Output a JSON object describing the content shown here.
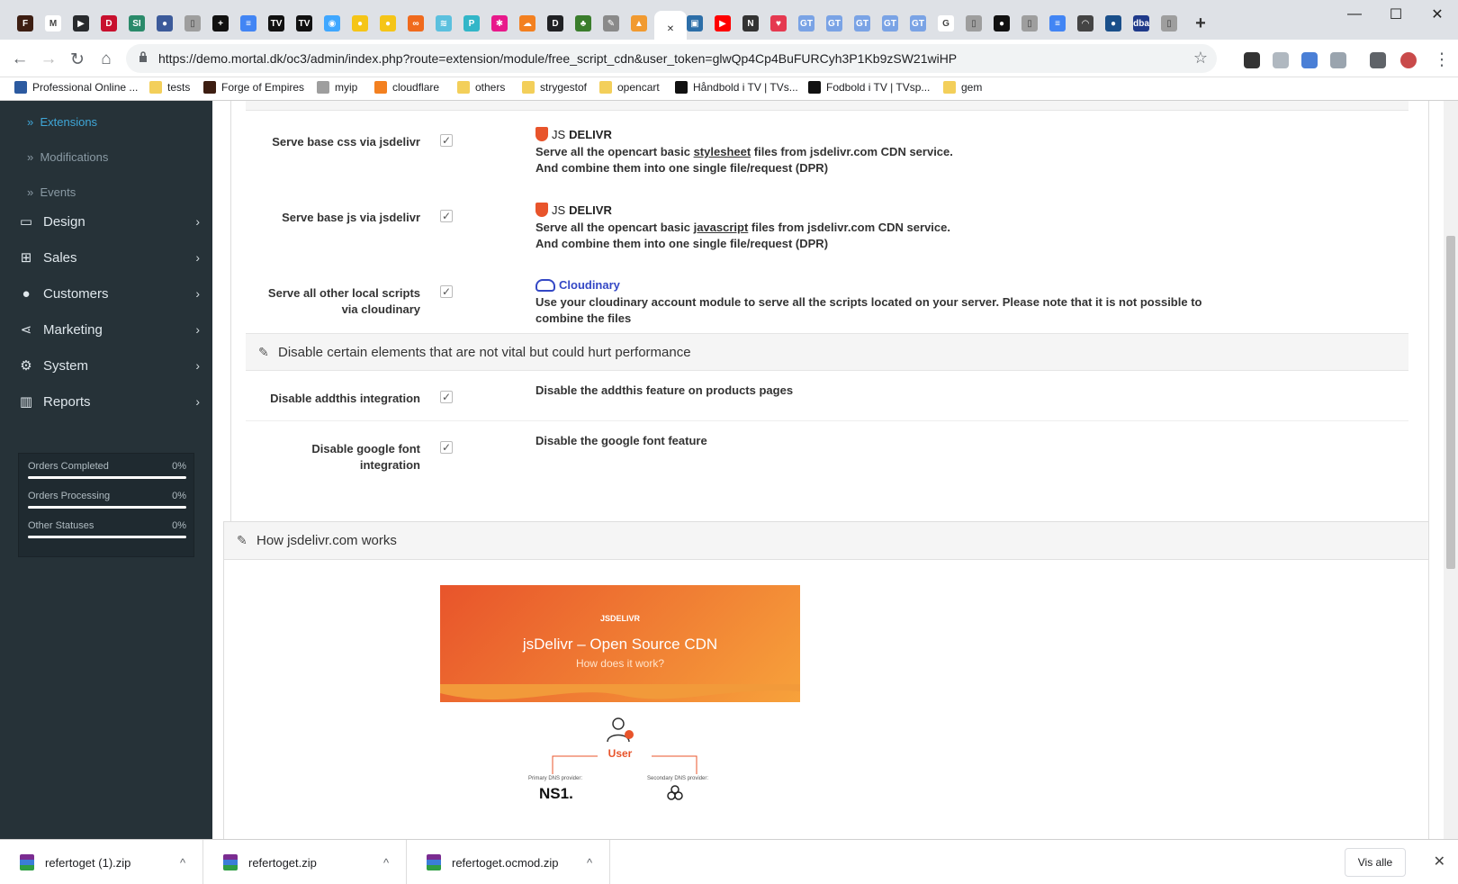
{
  "browser": {
    "tabs": [
      {
        "icon": "forge-icon",
        "color": "#3d1e12",
        "glyph": "F"
      },
      {
        "icon": "gmail-icon",
        "color": "#ffffff",
        "glyph": "M"
      },
      {
        "icon": "plex-icon",
        "color": "#282a2d",
        "glyph": "▶"
      },
      {
        "icon": "d-icon",
        "color": "#c8102e",
        "glyph": "D"
      },
      {
        "icon": "si-icon",
        "color": "#2a8a6a",
        "glyph": "SI"
      },
      {
        "icon": "avatar-tab-icon",
        "color": "#3c5a9a",
        "glyph": "●"
      },
      {
        "icon": "page-icon",
        "color": "#9e9e9e",
        "glyph": "▯"
      },
      {
        "icon": "plus-tab-icon",
        "color": "#111111",
        "glyph": "+"
      },
      {
        "icon": "docs-icon",
        "color": "#4285f4",
        "glyph": "≡"
      },
      {
        "icon": "tv-icon",
        "color": "#111111",
        "glyph": "TV"
      },
      {
        "icon": "tv2-icon",
        "color": "#111111",
        "glyph": "TV"
      },
      {
        "icon": "blue-circle-icon",
        "color": "#3fa7ff",
        "glyph": "◉"
      },
      {
        "icon": "yellow-icon",
        "color": "#f5c518",
        "glyph": "●"
      },
      {
        "icon": "yellow2-icon",
        "color": "#f5c518",
        "glyph": "●"
      },
      {
        "icon": "orange-link-icon",
        "color": "#f06a1d",
        "glyph": "∞"
      },
      {
        "icon": "chart-tab-icon",
        "color": "#5bc0de",
        "glyph": "≋"
      },
      {
        "icon": "p-icon",
        "color": "#32b6c8",
        "glyph": "P"
      },
      {
        "icon": "pink-icon",
        "color": "#e8198b",
        "glyph": "✱"
      },
      {
        "icon": "cloudflare-tab-icon",
        "color": "#f38020",
        "glyph": "☁"
      },
      {
        "icon": "d-dark-icon",
        "color": "#202124",
        "glyph": "D"
      },
      {
        "icon": "green-icon",
        "color": "#3a7d2c",
        "glyph": "♣"
      },
      {
        "icon": "feather-icon",
        "color": "#8a8a8a",
        "glyph": "✎"
      },
      {
        "icon": "pma-icon",
        "color": "#f19a30",
        "glyph": "▲"
      },
      {
        "icon": "close-tab-icon",
        "color": "#ffffff",
        "glyph": "✕"
      },
      {
        "icon": "film-icon",
        "color": "#2c6ea8",
        "glyph": "▣"
      },
      {
        "icon": "youtube-icon",
        "color": "#ff0000",
        "glyph": "▶"
      },
      {
        "icon": "n-icon",
        "color": "#333333",
        "glyph": "N"
      },
      {
        "icon": "heart-icon",
        "color": "#e53950",
        "glyph": "♥"
      },
      {
        "icon": "gt-icon",
        "color": "#7aa3e5",
        "glyph": "GT"
      },
      {
        "icon": "gt-icon",
        "color": "#7aa3e5",
        "glyph": "GT"
      },
      {
        "icon": "gt-icon",
        "color": "#7aa3e5",
        "glyph": "GT"
      },
      {
        "icon": "gt-icon",
        "color": "#7aa3e5",
        "glyph": "GT"
      },
      {
        "icon": "gt-icon",
        "color": "#7aa3e5",
        "glyph": "GT"
      },
      {
        "icon": "google-icon",
        "color": "#ffffff",
        "glyph": "G"
      },
      {
        "icon": "page-icon",
        "color": "#9e9e9e",
        "glyph": "▯"
      },
      {
        "icon": "github-icon",
        "color": "#111111",
        "glyph": "●"
      },
      {
        "icon": "page-icon",
        "color": "#9e9e9e",
        "glyph": "▯"
      },
      {
        "icon": "docs-icon",
        "color": "#4285f4",
        "glyph": "≡"
      },
      {
        "icon": "gauge-icon",
        "color": "#444444",
        "glyph": "◠"
      },
      {
        "icon": "globe-icon",
        "color": "#1a4f8a",
        "glyph": "●"
      },
      {
        "icon": "dba-icon",
        "color": "#1f3a8a",
        "glyph": "dba"
      },
      {
        "icon": "page-icon",
        "color": "#9e9e9e",
        "glyph": "▯"
      }
    ],
    "new_tab": "+",
    "window_controls": [
      "—",
      "☐",
      "✕"
    ],
    "url": "https://demo.mortal.dk/oc3/admin/index.php?route=extension/module/free_script_cdn&user_token=glwQp4Cp4BuFURCyh3P1Kb9zSW21wiHP",
    "bookmarks": [
      {
        "label": "Professional Online ...",
        "icon": "s-logo-icon",
        "color": "#2c5aa0"
      },
      {
        "label": "tests",
        "icon": "folder-icon",
        "color": "#f3cf5a"
      },
      {
        "label": "Forge of Empires",
        "icon": "forge-icon",
        "color": "#3d1e12"
      },
      {
        "label": "myip",
        "icon": "page-icon",
        "color": "#9e9e9e"
      },
      {
        "label": "cloudflare",
        "icon": "cloudflare-icon",
        "color": "#f38020"
      },
      {
        "label": "others",
        "icon": "folder-icon",
        "color": "#f3cf5a"
      },
      {
        "label": "strygestof",
        "icon": "folder-icon",
        "color": "#f3cf5a"
      },
      {
        "label": "opencart",
        "icon": "folder-icon",
        "color": "#f3cf5a"
      },
      {
        "label": "Håndbold i TV | TVs...",
        "icon": "tv-icon",
        "color": "#111111"
      },
      {
        "label": "Fodbold i TV | TVsp...",
        "icon": "tv-icon",
        "color": "#111111"
      },
      {
        "label": "gem",
        "icon": "folder-icon",
        "color": "#f3cf5a"
      }
    ]
  },
  "sidebar": {
    "sub_items": [
      {
        "label": "Extensions",
        "active": true
      },
      {
        "label": "Modifications",
        "active": false
      },
      {
        "label": "Events",
        "active": false
      }
    ],
    "sub_prefix": "»",
    "menu": [
      {
        "label": "Design",
        "icon": "desktop-icon",
        "glyph": "▭"
      },
      {
        "label": "Sales",
        "icon": "cart-icon",
        "glyph": "🛒"
      },
      {
        "label": "Customers",
        "icon": "user-icon",
        "glyph": "👤"
      },
      {
        "label": "Marketing",
        "icon": "share-icon",
        "glyph": "⋖"
      },
      {
        "label": "System",
        "icon": "cog-icon",
        "glyph": "⚙"
      },
      {
        "label": "Reports",
        "icon": "bar-chart-icon",
        "glyph": "▥"
      }
    ],
    "chevron": "›",
    "stats": [
      {
        "label": "Orders Completed",
        "value": "0%"
      },
      {
        "label": "Orders Processing",
        "value": "0%"
      },
      {
        "label": "Other Statuses",
        "value": "0%"
      }
    ]
  },
  "settings": {
    "rows": [
      {
        "label": "Serve base css via jsdelivr",
        "logo": "JSDELIVR",
        "logo_prefix": "JS",
        "logo_main": "DELIVR",
        "desc_pre": "Serve all the opencart basic ",
        "desc_link": "stylesheet",
        "desc_post": " files from jsdelivr.com CDN service.",
        "desc2": "And combine them into one single file/request (DPR)"
      },
      {
        "label": "Serve base js via jsdelivr",
        "logo": "JSDELIVR",
        "logo_prefix": "JS",
        "logo_main": "DELIVR",
        "desc_pre": "Serve all the opencart basic ",
        "desc_link": "javascript",
        "desc_post": " files from jsdelivr.com CDN service.",
        "desc2": "And combine them into one single file/request (DPR)"
      }
    ],
    "cloud_row": {
      "label1": "Serve all other local scripts",
      "label2": "via cloudinary",
      "logo": "Cloudinary",
      "desc1": "Use your cloudinary account module to serve all the scripts located on your server. Please note that it is not possible to",
      "desc2": "combine the files"
    },
    "section2_title": "Disable certain elements that are not vital but could hurt performance",
    "disable_rows": [
      {
        "label": "Disable addthis integration",
        "label2": "",
        "desc": "Disable the addthis feature on products pages"
      },
      {
        "label": "Disable google font",
        "label2": "integration",
        "desc": "Disable the google font feature"
      }
    ],
    "checkmark": "✓",
    "pencil": "✎"
  },
  "how": {
    "title": "How jsdelivr.com works",
    "hero_brand": "JSDELIVR",
    "hero_title": "jsDelivr – Open Source CDN",
    "hero_sub": "How does it work?",
    "user": "User",
    "primary_dns": "Primary DNS provider:",
    "secondary_dns": "Secondary DNS provider:",
    "ns1": "NS1."
  },
  "downloads": {
    "items": [
      "refertoget (1).zip",
      "refertoget.zip",
      "refertoget.ocmod.zip"
    ],
    "caret": "^",
    "show_all": "Vis alle",
    "close": "✕"
  }
}
